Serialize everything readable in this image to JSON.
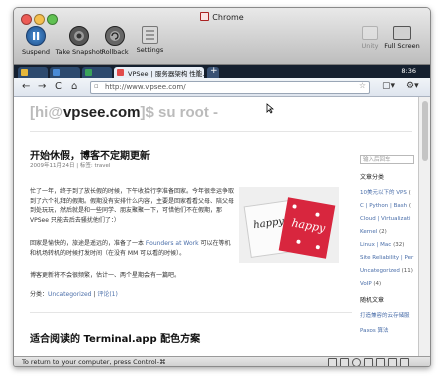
{
  "window": {
    "title": "Chrome"
  },
  "vm_toolbar": [
    {
      "label": "Suspend",
      "icon": "pause-icon"
    },
    {
      "label": "Take Snapshot",
      "icon": "snapshot-icon"
    },
    {
      "label": "Rollback",
      "icon": "rollback-icon"
    },
    {
      "label": "Settings",
      "icon": "settings-icon"
    },
    {
      "label": "Unity",
      "icon": "unity-icon"
    },
    {
      "label": "Full Screen",
      "icon": "fullscreen-icon"
    }
  ],
  "tabs": [
    {
      "label": "VPSee | 服务器架构 性能..."
    }
  ],
  "clock": "8:36",
  "omnibox": {
    "url": "http://www.vpsee.com/"
  },
  "site": {
    "prefix": "[hi@",
    "name": "vpsee.com",
    "suffix": "]$ su root -"
  },
  "post1": {
    "title": "开始休假，博客不定期更新",
    "meta": "2009年11月24日 | 标签: travel",
    "p1": "忙了一年，终于到了放长假的时候，下午收拾行李准备回家。今年很幸运争取到了六个礼拜的假期。假期没有安排什么内容，主要是回家看看父母、陪父母到处玩玩，然后就是和一些同学、朋友聚聚一下，可惜他们不在假期，那 VPSee 只能去后去骚扰他们了：）",
    "p2a": "回家是愉快的，旅途是遥远的，准备了一本 ",
    "p2link": "Founders at Work",
    "p2b": " 可以在等机和机场转机的时候打发时间（在没有 MM 可以看的时候）。",
    "p3": "博客更新将不会很频繁，估计一、两个星期会有一篇吧。",
    "cat_label": "分类：",
    "cat_link": "Uncategorized",
    "comments": "评论(1)",
    "photo_text": "happy"
  },
  "post2": {
    "title": "适合阅读的 Terminal.app 配色方案"
  },
  "sidebar": {
    "search_placeholder": "输入后回车",
    "categories_heading": "文章分类",
    "categories": [
      {
        "name": "10美元以下的 VPS",
        "count": "("
      },
      {
        "name": "C | Python | Bash",
        "count": "("
      },
      {
        "name": "Cloud | Virtualizati",
        "count": ""
      },
      {
        "name": "Kernel",
        "count": "(2)"
      },
      {
        "name": "Linux | Mac",
        "count": "(32)"
      },
      {
        "name": "Site Reliability | Per",
        "count": ""
      },
      {
        "name": "Uncategorized",
        "count": "(11)"
      },
      {
        "name": "VoIP",
        "count": "(4)"
      }
    ],
    "random_heading": "随机文章",
    "random": [
      {
        "name": "打造兼容的云存储服"
      },
      {
        "name": "Paxos 算法"
      }
    ]
  },
  "statusbar": {
    "text": "To return to your computer, press Control-⌘"
  }
}
